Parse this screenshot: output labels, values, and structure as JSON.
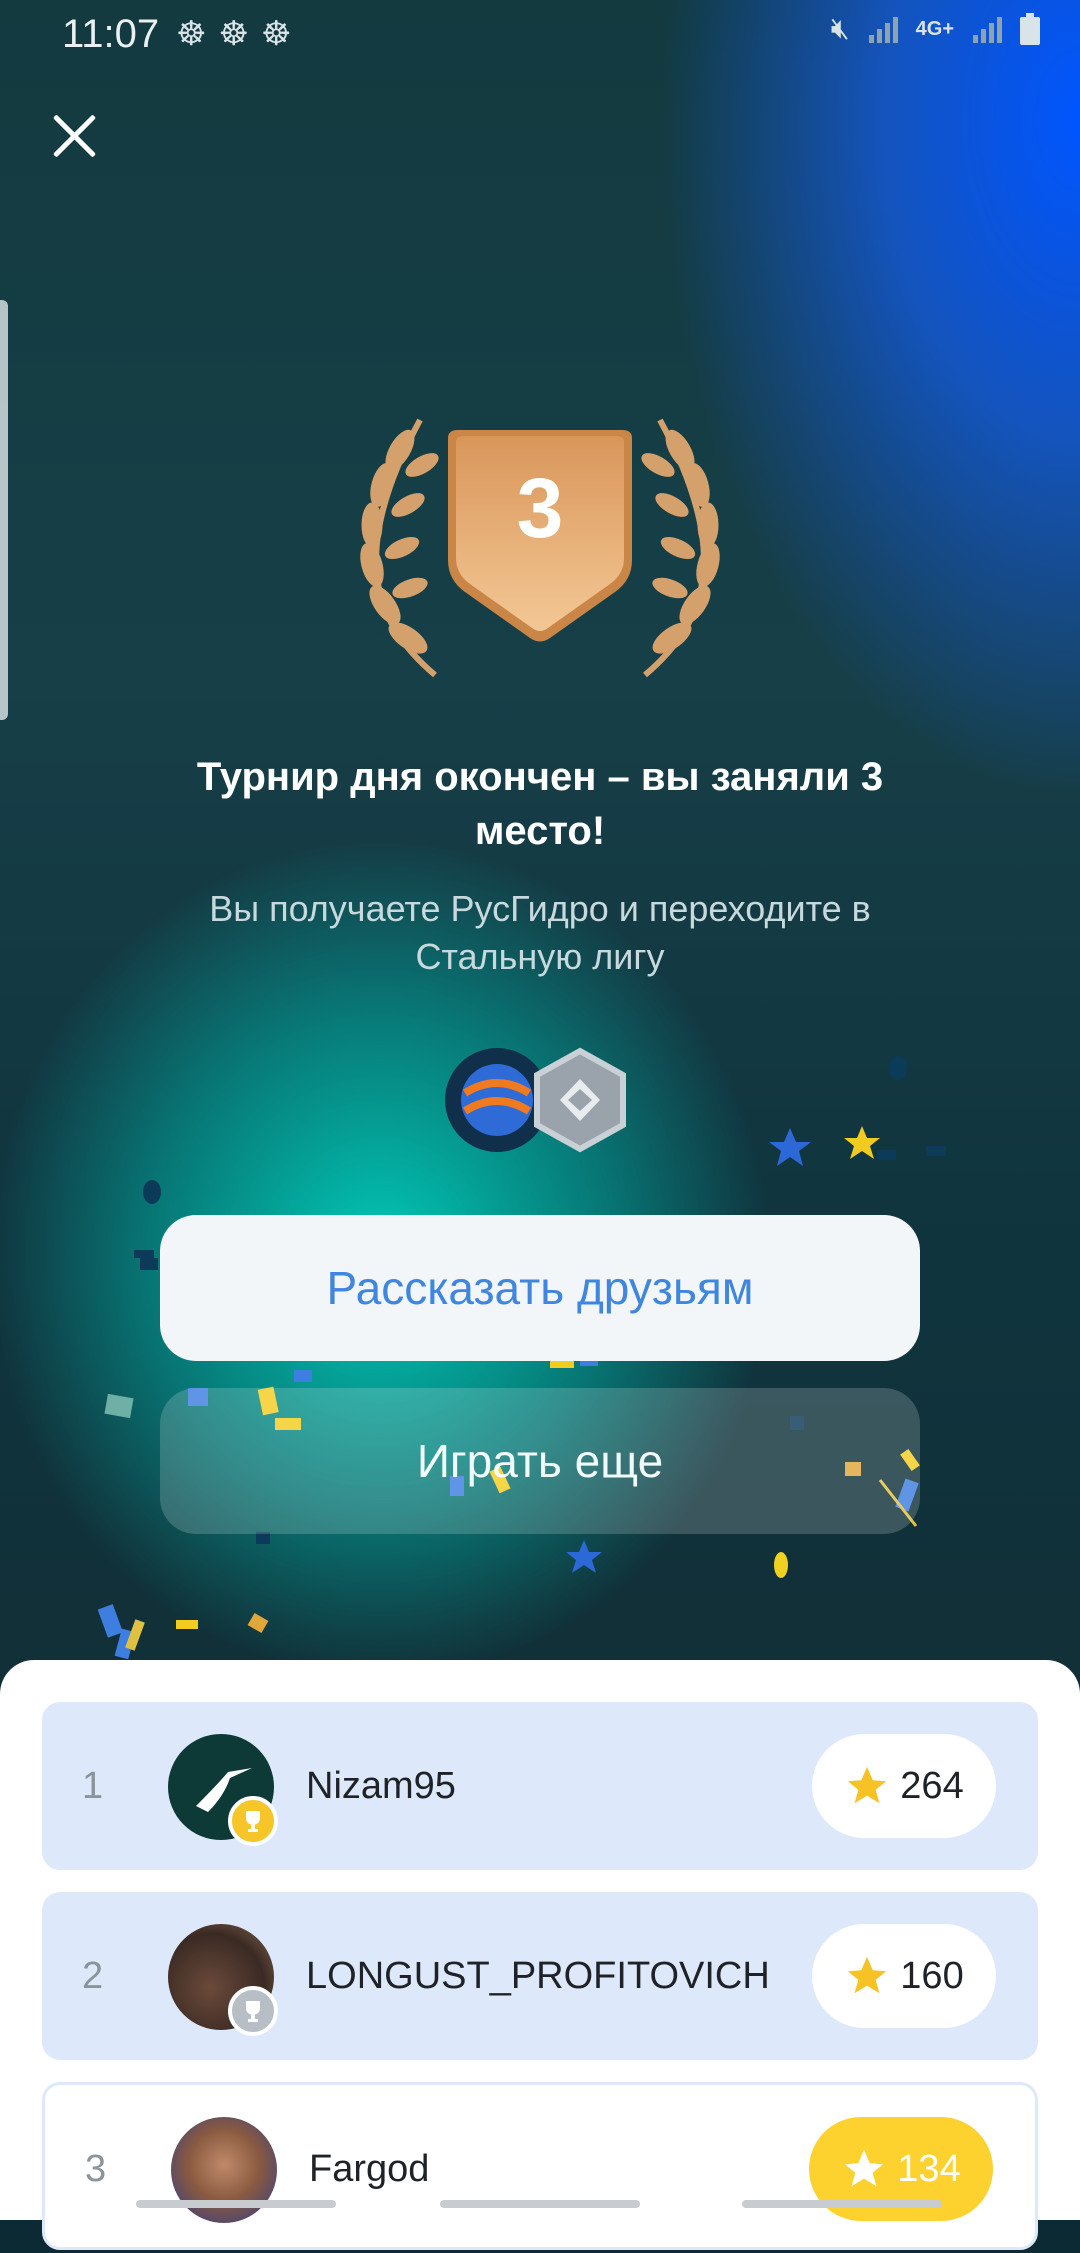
{
  "status_bar": {
    "time": "11:07",
    "left_icons": [
      "app-notification-icon",
      "app-notification-icon",
      "app-notification-icon"
    ],
    "right_icons": [
      "mute-icon",
      "signal-icon",
      "4g-plus-icon",
      "signal-icon",
      "battery-icon"
    ],
    "network": "4G+"
  },
  "result": {
    "place": "3",
    "title": "Турнир дня окончен – вы заняли 3 место!",
    "subtitle": "Вы получаете РусГидро и переходите в Стальную лигу",
    "colors": {
      "medal": "#e0a063",
      "accent_blue": "#3e86de",
      "leaf": "#d4a16c"
    }
  },
  "buttons": {
    "share_label": "Рассказать друзьям",
    "play_again_label": "Играть еще"
  },
  "leaderboard": {
    "rows": [
      {
        "rank": "1",
        "name": "Nizam95",
        "score": "264",
        "badge": "gold-trophy-icon"
      },
      {
        "rank": "2",
        "name": "LONGUST_PROFITOVICH",
        "score": "160",
        "badge": "silver-trophy-icon"
      },
      {
        "rank": "3",
        "name": "Fargod",
        "score": "134",
        "badge": ""
      }
    ]
  }
}
